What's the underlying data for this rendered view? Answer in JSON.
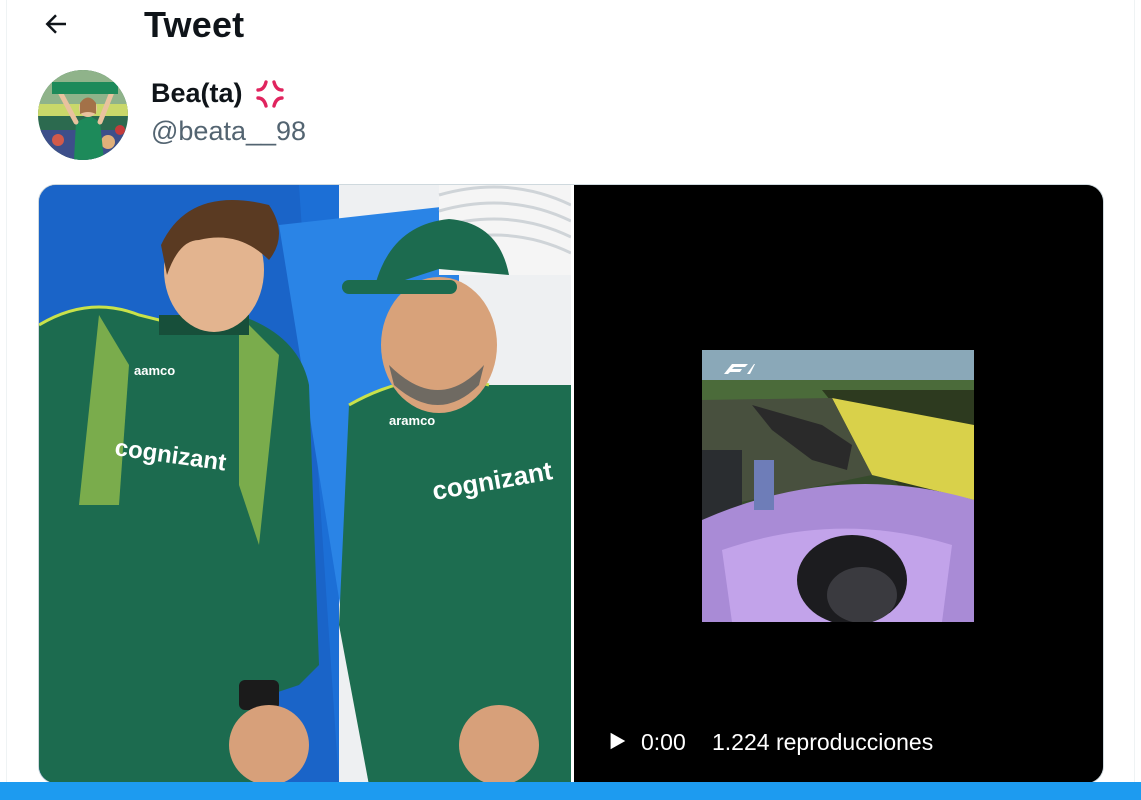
{
  "header": {
    "title": "Tweet"
  },
  "author": {
    "display_name": "Bea(ta)",
    "handle": "@beata__98"
  },
  "video": {
    "time": "0:00",
    "views": "1.224 reproducciones"
  },
  "colors": {
    "accent": "#1d9bf0",
    "handle_gray": "#536471",
    "text": "#0f1419"
  },
  "icons": {
    "back": "arrow-left-icon",
    "name_emoji": "anger-symbol-icon",
    "play": "play-icon",
    "f1_logo": "f1-logo-icon"
  }
}
